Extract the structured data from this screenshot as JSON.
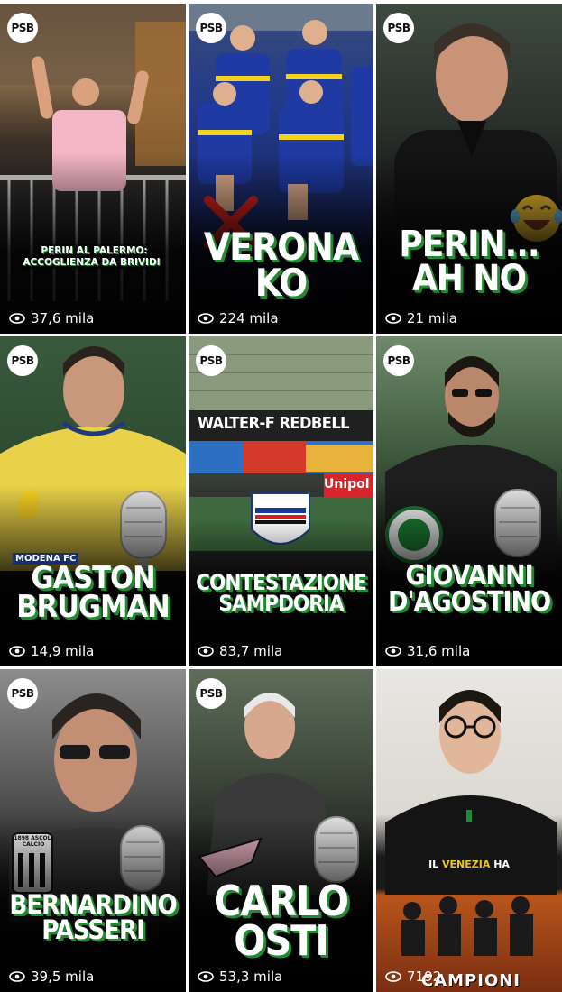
{
  "brand": {
    "logo_text": "PSB"
  },
  "tiles": [
    {
      "headline": "PERIN AL PALERMO:\nACCOGLIENZA DA BRIVIDI",
      "views": "37,6 mila"
    },
    {
      "headline": "VERONA\nKO",
      "views": "224 mila"
    },
    {
      "headline": "PERIN...\nAH NO",
      "views": "21 mila"
    },
    {
      "headline": "GASTON\nBRUGMAN",
      "views": "14,9 mila",
      "badge": "MODENA FC"
    },
    {
      "headline": "CONTESTAZIONE\nSAMPDORIA",
      "views": "83,7 mila",
      "banner": "WALTER-F REDBELL",
      "banner2": "Unipol"
    },
    {
      "headline": "GIOVANNI\nD'AGOSTINO",
      "views": "31,6 mila"
    },
    {
      "headline": "BERNARDINO\nPASSERI",
      "views": "39,5 mila",
      "badge": "1898 ASCOLI CALCIO"
    },
    {
      "headline": "CARLO\nOSTI",
      "views": "53,3 mila"
    },
    {
      "caption_pre": "IL ",
      "caption_hl": "VENEZIA",
      "caption_post": " HA",
      "views": "7192",
      "overlay_text": "CAMPIONI"
    }
  ],
  "colors": {
    "accent_green": "#1f8a2f",
    "border_green": "#2c6b3a",
    "highlight_yellow": "#f2c417"
  },
  "icons": {
    "views": "eye-icon",
    "emoji": "laughing-tears-emoji",
    "mark": "red-x-icon",
    "mic": "microphone-icon"
  }
}
